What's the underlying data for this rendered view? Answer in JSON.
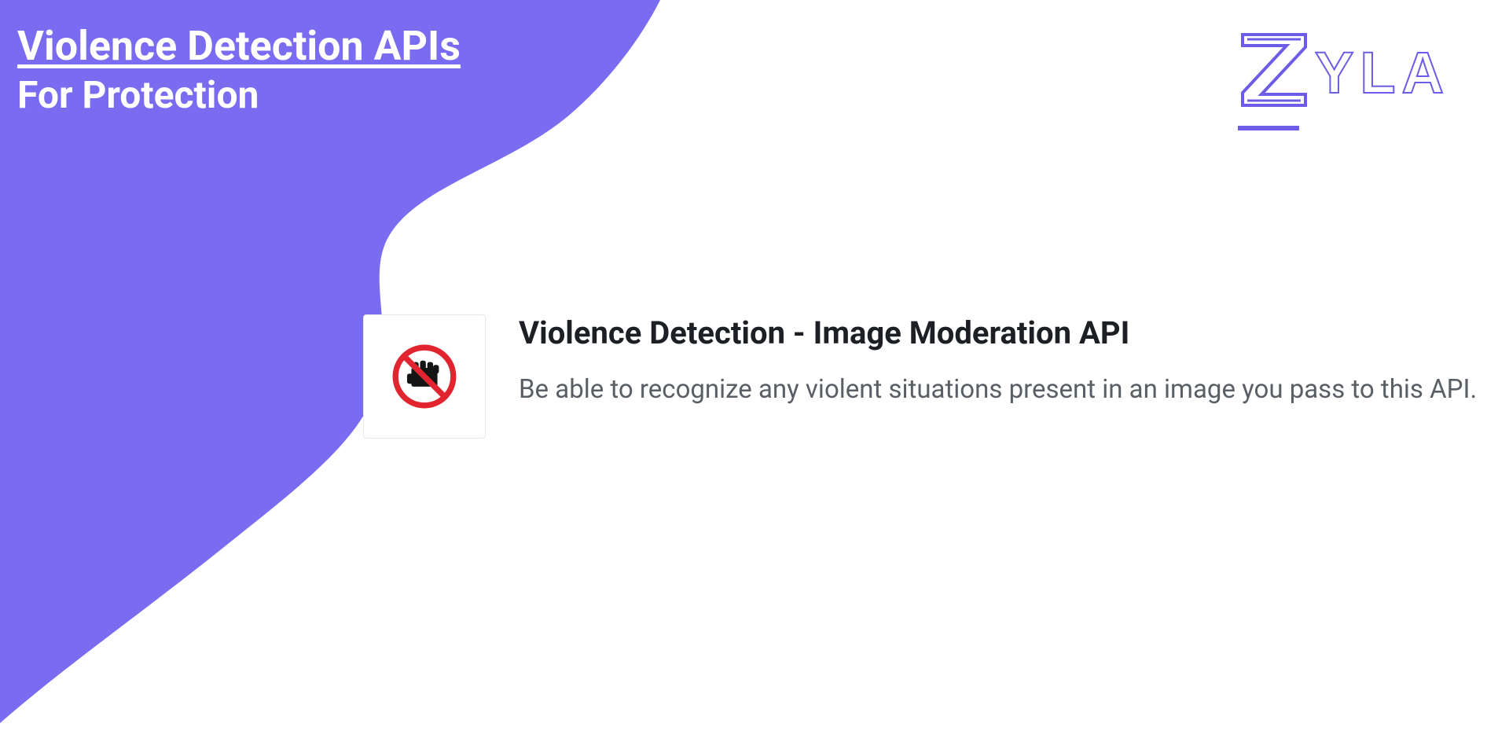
{
  "hero": {
    "title": "Violence Detection APIs",
    "subtitle": "For Protection"
  },
  "brand": {
    "z": "Z",
    "rest": "YLA"
  },
  "card": {
    "title": "Violence Detection - Image Moderation API",
    "description": "Be able to recognize any violent situations present in an image you pass to this API.",
    "icon_name": "no-violence-icon"
  },
  "colors": {
    "accent": "#7a6cf0",
    "brand": "#6c5ce7",
    "text_dark": "#1c1f23",
    "text_muted": "#5a5f66"
  }
}
